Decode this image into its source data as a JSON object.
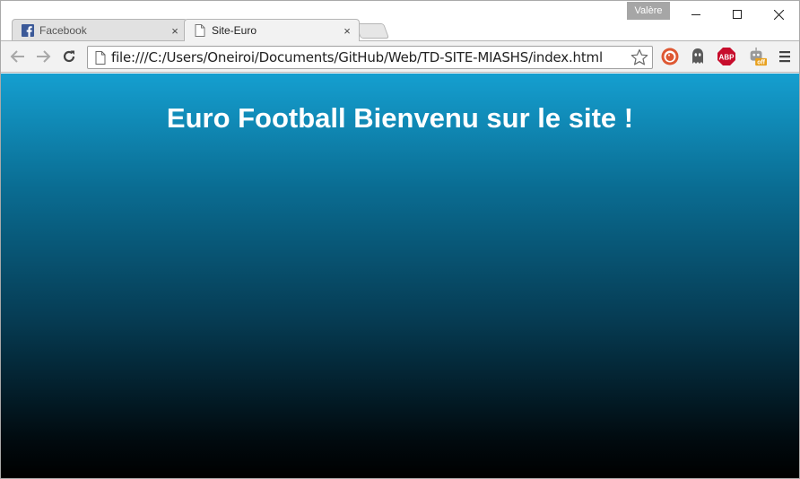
{
  "window": {
    "profile_name": "Valère"
  },
  "tabs": [
    {
      "label": "Facebook",
      "favicon": "facebook-icon",
      "active": false
    },
    {
      "label": "Site-Euro",
      "favicon": "page-icon",
      "active": true
    }
  ],
  "tab_close_glyph": "×",
  "toolbar": {
    "url": "file:///C:/Users/Oneiroi/Documents/GitHub/Web/TD-SITE-MIASHS/index.html"
  },
  "extensions": {
    "abp_label": "ABP",
    "robot_badge": "off"
  },
  "page": {
    "heading": "Euro Football Bienvenu sur le site !"
  },
  "colors": {
    "gradient_top": "#159fd0",
    "gradient_bottom": "#000000",
    "heading_text": "#ffffff"
  }
}
